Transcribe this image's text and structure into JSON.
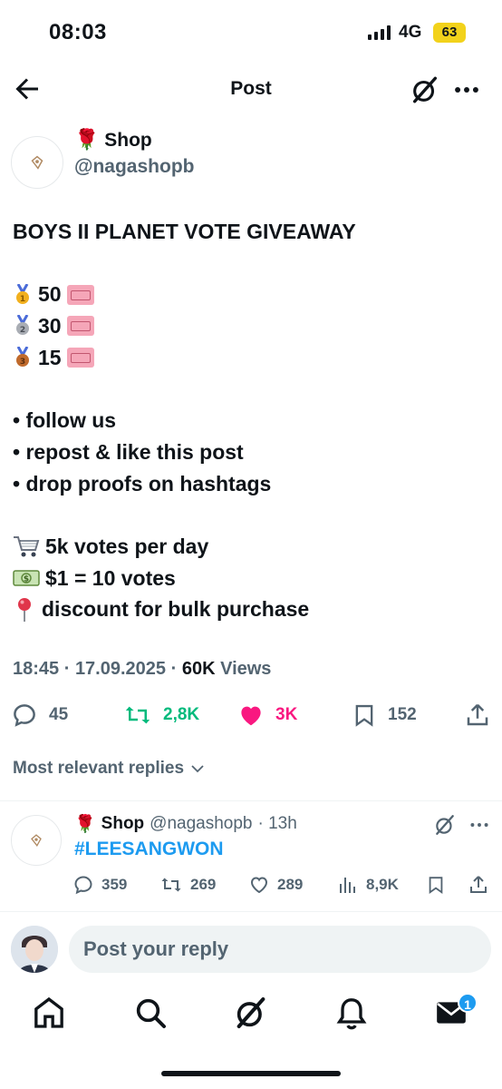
{
  "status_bar": {
    "time": "08:03",
    "network": "4G",
    "battery": "63"
  },
  "header": {
    "title": "Post"
  },
  "post": {
    "author_name": "Shop",
    "author_handle": "@nagashopb",
    "lines": {
      "title": "BOYS II PLANET VOTE GIVEAWAY",
      "prize1": "50",
      "prize2": "30",
      "prize3": "15",
      "rule1": "• follow us",
      "rule2": "• repost & like this post",
      "rule3": "• drop proofs on hashtags",
      "info1": "5k votes per day",
      "info2": "$1 = 10 votes",
      "info3": "discount for bulk purchase"
    },
    "time": "18:45",
    "date": "17.09.2025",
    "views": "60K",
    "views_label": "Views",
    "stats": {
      "replies": "45",
      "reposts": "2,8K",
      "likes": "3K",
      "bookmarks": "152"
    },
    "colors": {
      "repost": "#00ba7c",
      "like": "#f91880"
    }
  },
  "replies_filter": "Most relevant replies",
  "reply": {
    "name": "Shop",
    "handle": "@nagashopb",
    "age": "· 13h",
    "text": "#LEESANGWON",
    "stats": {
      "replies": "359",
      "reposts": "269",
      "likes": "289",
      "views": "8,9K"
    }
  },
  "composer": {
    "placeholder": "Post your reply"
  },
  "tabbar": {
    "notification_badge": "1"
  },
  "icons": [
    "back-arrow-icon",
    "grok-icon",
    "more-icon",
    "rose-icon",
    "medal-icon",
    "ticket-icon",
    "cart-icon",
    "money-icon",
    "pin-icon",
    "reply-icon",
    "repost-icon",
    "heart-icon",
    "bookmark-icon",
    "share-icon",
    "views-icon",
    "home-icon",
    "search-icon",
    "bell-icon",
    "mail-icon"
  ]
}
